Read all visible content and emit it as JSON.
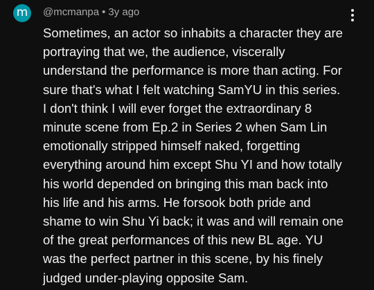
{
  "comment": {
    "avatar_letter": "m",
    "avatar_color": "#0097a7",
    "author": "@mcmanpa",
    "separator": "•",
    "time_ago": "3y ago",
    "more_icon": "more-vert-icon",
    "lines": [
      "Sometimes, an actor so inhabits a character they are",
      "portraying that we, the audience, viscerally",
      "understand the performance is more than acting. For",
      "sure that's what I felt watching SamYU in this series.",
      "I don't think I will ever forget the extraordinary 8",
      "minute scene from Ep.2 in Series 2 when Sam Lin",
      "emotionally stripped himself naked, forgetting",
      "everything around him except Shu YI and how totally",
      "his world depended on bringing this man back into",
      "his life and his arms. He forsook both pride and",
      "shame to win Shu Yi back; it was and will remain one",
      "of the great performances of this new BL age. YU",
      "was the perfect partner in this scene, by his finely",
      "judged under-playing opposite Sam."
    ]
  }
}
